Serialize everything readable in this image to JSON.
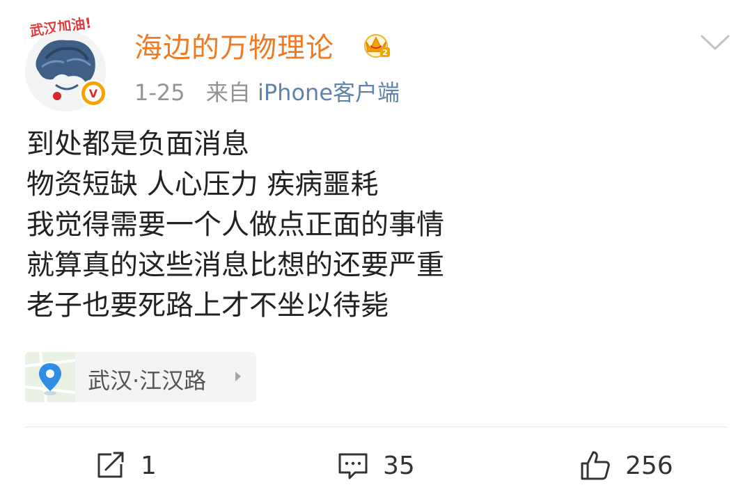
{
  "author": {
    "name": "海边的万物理论",
    "avatar_badge_text": "武汉加油!",
    "verified_mark": "V",
    "vip_level": "2"
  },
  "meta": {
    "time": "1-25",
    "source_prefix": "来自",
    "source_client": "iPhone客户端"
  },
  "post": {
    "lines": [
      "到处都是负面消息",
      "物资短缺 人心压力 疾病噩耗",
      "我觉得需要一个人做点正面的事情",
      "就算真的这些消息比想的还要严重",
      "老子也要死路上才不坐以待毙"
    ]
  },
  "location": {
    "label": "武汉·江汉路"
  },
  "actions": {
    "repost_count": "1",
    "comment_count": "35",
    "like_count": "256"
  },
  "colors": {
    "username": "#f07a22",
    "source_link": "#5e83ad",
    "verified_badge": "#f5a300"
  },
  "icons": {
    "more": "chevron-down-icon",
    "location": "location-pin-icon",
    "repost": "repost-icon",
    "comment": "comment-icon",
    "like": "thumbs-up-icon"
  }
}
